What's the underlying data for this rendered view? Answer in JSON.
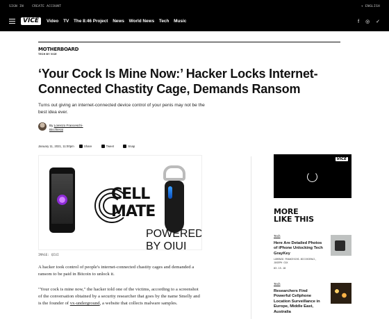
{
  "topbar": {
    "sign_in": "SIGN IN",
    "create_account": "CREATE ACCOUNT",
    "language": "+ ENGLISH"
  },
  "nav": {
    "logo": "VICE",
    "links": [
      "Video",
      "TV",
      "The 8:46 Project",
      "News",
      "World News",
      "Tech",
      "Music"
    ],
    "social_icons": [
      "facebook-icon",
      "instagram-icon",
      "twitter-icon"
    ]
  },
  "brand": {
    "name": "MOTHERBOARD",
    "sub": "TECH BY VICE"
  },
  "article": {
    "title": "‘Your Cock Is Mine Now:’ Hacker Locks Internet-Connected Chastity Cage, Demands Ransom",
    "dek": "Turns out giving an internet-connected device control of your penis may not be the best idea ever.",
    "byline_prefix": "By",
    "author": "Lorenzo Franceschi-Bicchierai",
    "date": "January 11, 2021, 11:00pm",
    "share_labels": [
      "Share",
      "Tweet",
      "Snap"
    ],
    "image_credit": "IMAGE: QIUI",
    "hero": {
      "logo_line1": "CELL",
      "logo_line2": "MATE",
      "powered": "POWERED BY QIUI"
    },
    "paragraph1": "A hacker took control of people's internet-connected chastity cages and demanded a ransom to be paid in Bitcoin to unlock it.",
    "paragraph2_a": "\"Your cock is mine now,\" the hacker told one of the victims, according to a screenshot of the conversation obtained by a security researcher that goes by the name Smelly and is the founder of ",
    "paragraph2_link": "vx-underground",
    "paragraph2_b": ", a website that collects malware samples."
  },
  "sidebar": {
    "video_logo": "VICE",
    "more_title_1": "MORE",
    "more_title_2": "LIKE THIS",
    "cards": [
      {
        "category": "Tech",
        "title": "Here Are Detailed Photos of iPhone Unlocking Tech GrayKey",
        "author": "LORENZO FRANCESCHI-BICCHIERAI, JOSEPH COX",
        "date": "03.15.18"
      },
      {
        "category": "Tech",
        "title": "Researchers Find Powerful Cellphone Location Surveillance in Europe, Middle East, Australia"
      }
    ]
  }
}
